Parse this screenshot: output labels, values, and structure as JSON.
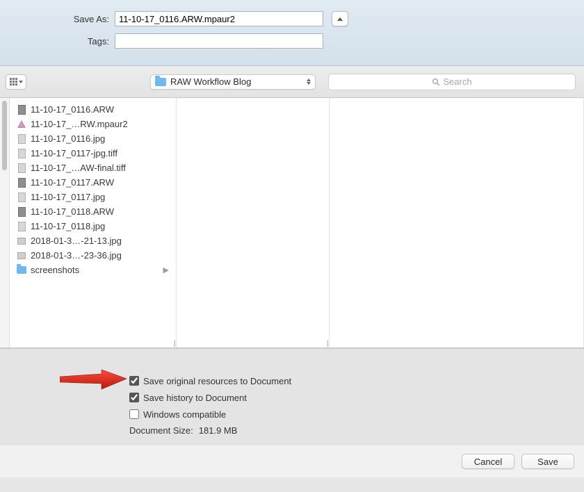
{
  "header": {
    "save_as_label": "Save As:",
    "save_as_value": "11-10-17_0116.ARW.mpaur2",
    "tags_label": "Tags:",
    "tags_value": ""
  },
  "toolbar": {
    "folder_label": "RAW Workflow Blog",
    "search_placeholder": "Search"
  },
  "files": [
    {
      "icon": "doc-dark",
      "name": "11-10-17_0116.ARW"
    },
    {
      "icon": "triangle",
      "name": "11-10-17_…RW.mpaur2"
    },
    {
      "icon": "doc",
      "name": "11-10-17_0116.jpg"
    },
    {
      "icon": "doc",
      "name": "11-10-17_0117-jpg.tiff"
    },
    {
      "icon": "doc",
      "name": "11-10-17_…AW-final.tiff"
    },
    {
      "icon": "doc-dark",
      "name": "11-10-17_0117.ARW"
    },
    {
      "icon": "doc",
      "name": "11-10-17_0117.jpg"
    },
    {
      "icon": "doc-dark",
      "name": "11-10-17_0118.ARW"
    },
    {
      "icon": "doc",
      "name": "11-10-17_0118.jpg"
    },
    {
      "icon": "jpg",
      "name": "2018-01-3…-21-13.jpg"
    },
    {
      "icon": "jpg",
      "name": "2018-01-3…-23-36.jpg"
    },
    {
      "icon": "folder",
      "name": "screenshots",
      "children": true
    }
  ],
  "options": {
    "save_resources": {
      "checked": true,
      "label": "Save original resources to Document"
    },
    "save_history": {
      "checked": true,
      "label": "Save history to Document"
    },
    "windows_compat": {
      "checked": false,
      "label": "Windows compatible"
    },
    "doc_size_label": "Document Size:",
    "doc_size_value": "181.9 MB"
  },
  "footer": {
    "cancel_label": "Cancel",
    "save_label": "Save"
  }
}
